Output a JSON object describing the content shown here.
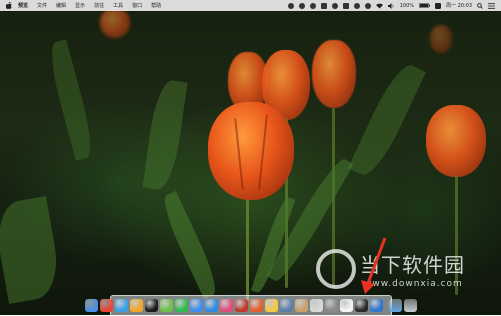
{
  "menubar": {
    "app_name": "预览",
    "items": [
      "文件",
      "编辑",
      "显示",
      "前往",
      "工具",
      "窗口",
      "帮助"
    ],
    "battery": "100%",
    "clock": "周一 20:03"
  },
  "watermark": {
    "title": "当下软件园",
    "url": "www.downxia.com"
  },
  "dock": {
    "icons": [
      {
        "name": "finder-icon",
        "color": "#4a90e2"
      },
      {
        "name": "chrome-icon",
        "color": "#e94435"
      },
      {
        "name": "safari-icon",
        "color": "#3aa0e8"
      },
      {
        "name": "firefox-icon",
        "color": "#f5a623"
      },
      {
        "name": "qq-icon",
        "color": "#1b1b1b"
      },
      {
        "name": "butterfly-icon",
        "color": "#6cc04a"
      },
      {
        "name": "wechat-icon",
        "color": "#2dbb4f"
      },
      {
        "name": "messages-icon",
        "color": "#3b8ef0"
      },
      {
        "name": "app-store-icon",
        "color": "#2b8ae6"
      },
      {
        "name": "itunes-icon",
        "color": "#e14b7c"
      },
      {
        "name": "photo-booth-icon",
        "color": "#c0392b"
      },
      {
        "name": "weibo-icon",
        "color": "#e85b2a"
      },
      {
        "name": "photos-icon",
        "color": "#f7c843"
      },
      {
        "name": "preview-icon",
        "color": "#5c7fa8"
      },
      {
        "name": "contacts-icon",
        "color": "#c9a06a"
      },
      {
        "name": "font-book-icon",
        "color": "#d9d9d9"
      },
      {
        "name": "system-preferences-icon",
        "color": "#8a8a8a"
      },
      {
        "name": "calendar-icon",
        "color": "#f4f4f4"
      },
      {
        "name": "terminal-icon",
        "color": "#2a2a2a"
      },
      {
        "name": "xcode-icon",
        "color": "#2f74d0"
      }
    ],
    "right_icons": [
      {
        "name": "downloads-folder-icon",
        "color": "#5fa6e8"
      },
      {
        "name": "trash-icon",
        "color": "#c8cdd2"
      }
    ]
  }
}
